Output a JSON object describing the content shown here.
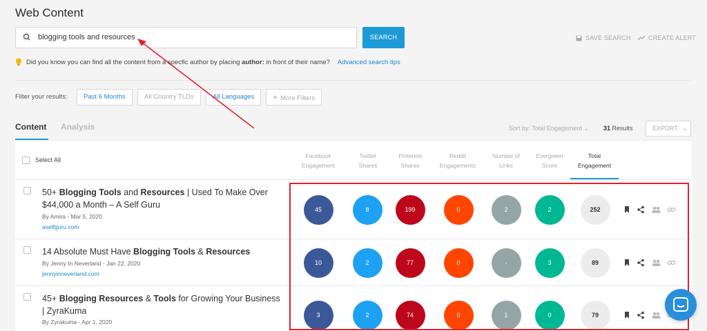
{
  "page_title": "Web Content",
  "search": {
    "query": "blogging tools and resources",
    "button_label": "SEARCH"
  },
  "top_actions": {
    "save_search": "SAVE SEARCH",
    "create_alert": "CREATE ALERT"
  },
  "tip": {
    "text_before": "Did you know you can find all the content from a specfic author by placing ",
    "keyword": "author:",
    "text_after": " in front of their name?",
    "link": "Advanced search tips"
  },
  "filters": {
    "label": "Filter your results:",
    "chips": [
      "Past 6 Months",
      "All Country TLDs",
      "All Languages",
      "More Filters"
    ]
  },
  "tabs": [
    "Content",
    "Analysis"
  ],
  "sort": {
    "label": "Sort by: Total Engagement",
    "count": "31",
    "results_label": "Results",
    "export_label": "EXPORT"
  },
  "table": {
    "select_all": "Select All",
    "columns": [
      {
        "line1": "Facebook",
        "line2": "Engagement"
      },
      {
        "line1": "Twitter",
        "line2": "Shares"
      },
      {
        "line1": "Pinterest",
        "line2": "Shares"
      },
      {
        "line1": "Reddit",
        "line2": "Engagements"
      },
      {
        "line1": "Number of",
        "line2": "Links"
      },
      {
        "line1": "Evergreen",
        "line2": "Score"
      },
      {
        "line1": "Total",
        "line2": "Engagement"
      }
    ],
    "rows": [
      {
        "title_parts": [
          "50+ ",
          "Blogging Tools",
          " and ",
          "Resources",
          " | Used To Make Over $44,000 a Month – A Self Guru"
        ],
        "meta": "By Amira - Mar 5, 2020",
        "domain": "aselfguru.com",
        "metrics": [
          "45",
          "8",
          "199",
          "0",
          "2",
          "2",
          "252"
        ]
      },
      {
        "title_parts": [
          "14 Absolute Must Have ",
          "Blogging Tools",
          " & ",
          "Resources",
          ""
        ],
        "meta": "By Jenny In Neverland - Jan 22, 2020",
        "domain": "jennyinneverland.com",
        "metrics": [
          "10",
          "2",
          "77",
          "0",
          "-",
          "3",
          "89"
        ]
      },
      {
        "title_parts": [
          "45+ ",
          "Blogging Resources",
          " & ",
          "Tools",
          " for Growing Your Business | ZyraKuma"
        ],
        "meta": "By Zyrakuma - Apr 1, 2020",
        "domain": "",
        "metrics": [
          "3",
          "2",
          "74",
          "0",
          "1",
          "0",
          "79"
        ]
      }
    ]
  },
  "colors": {
    "facebook": "#3b5998",
    "twitter": "#1da1f2",
    "pinterest": "#bd081c",
    "reddit": "#ff4500",
    "links": "#95a5a6",
    "evergreen": "#00b894",
    "accent": "#1e9ad6",
    "annotation": "#e4202c"
  }
}
